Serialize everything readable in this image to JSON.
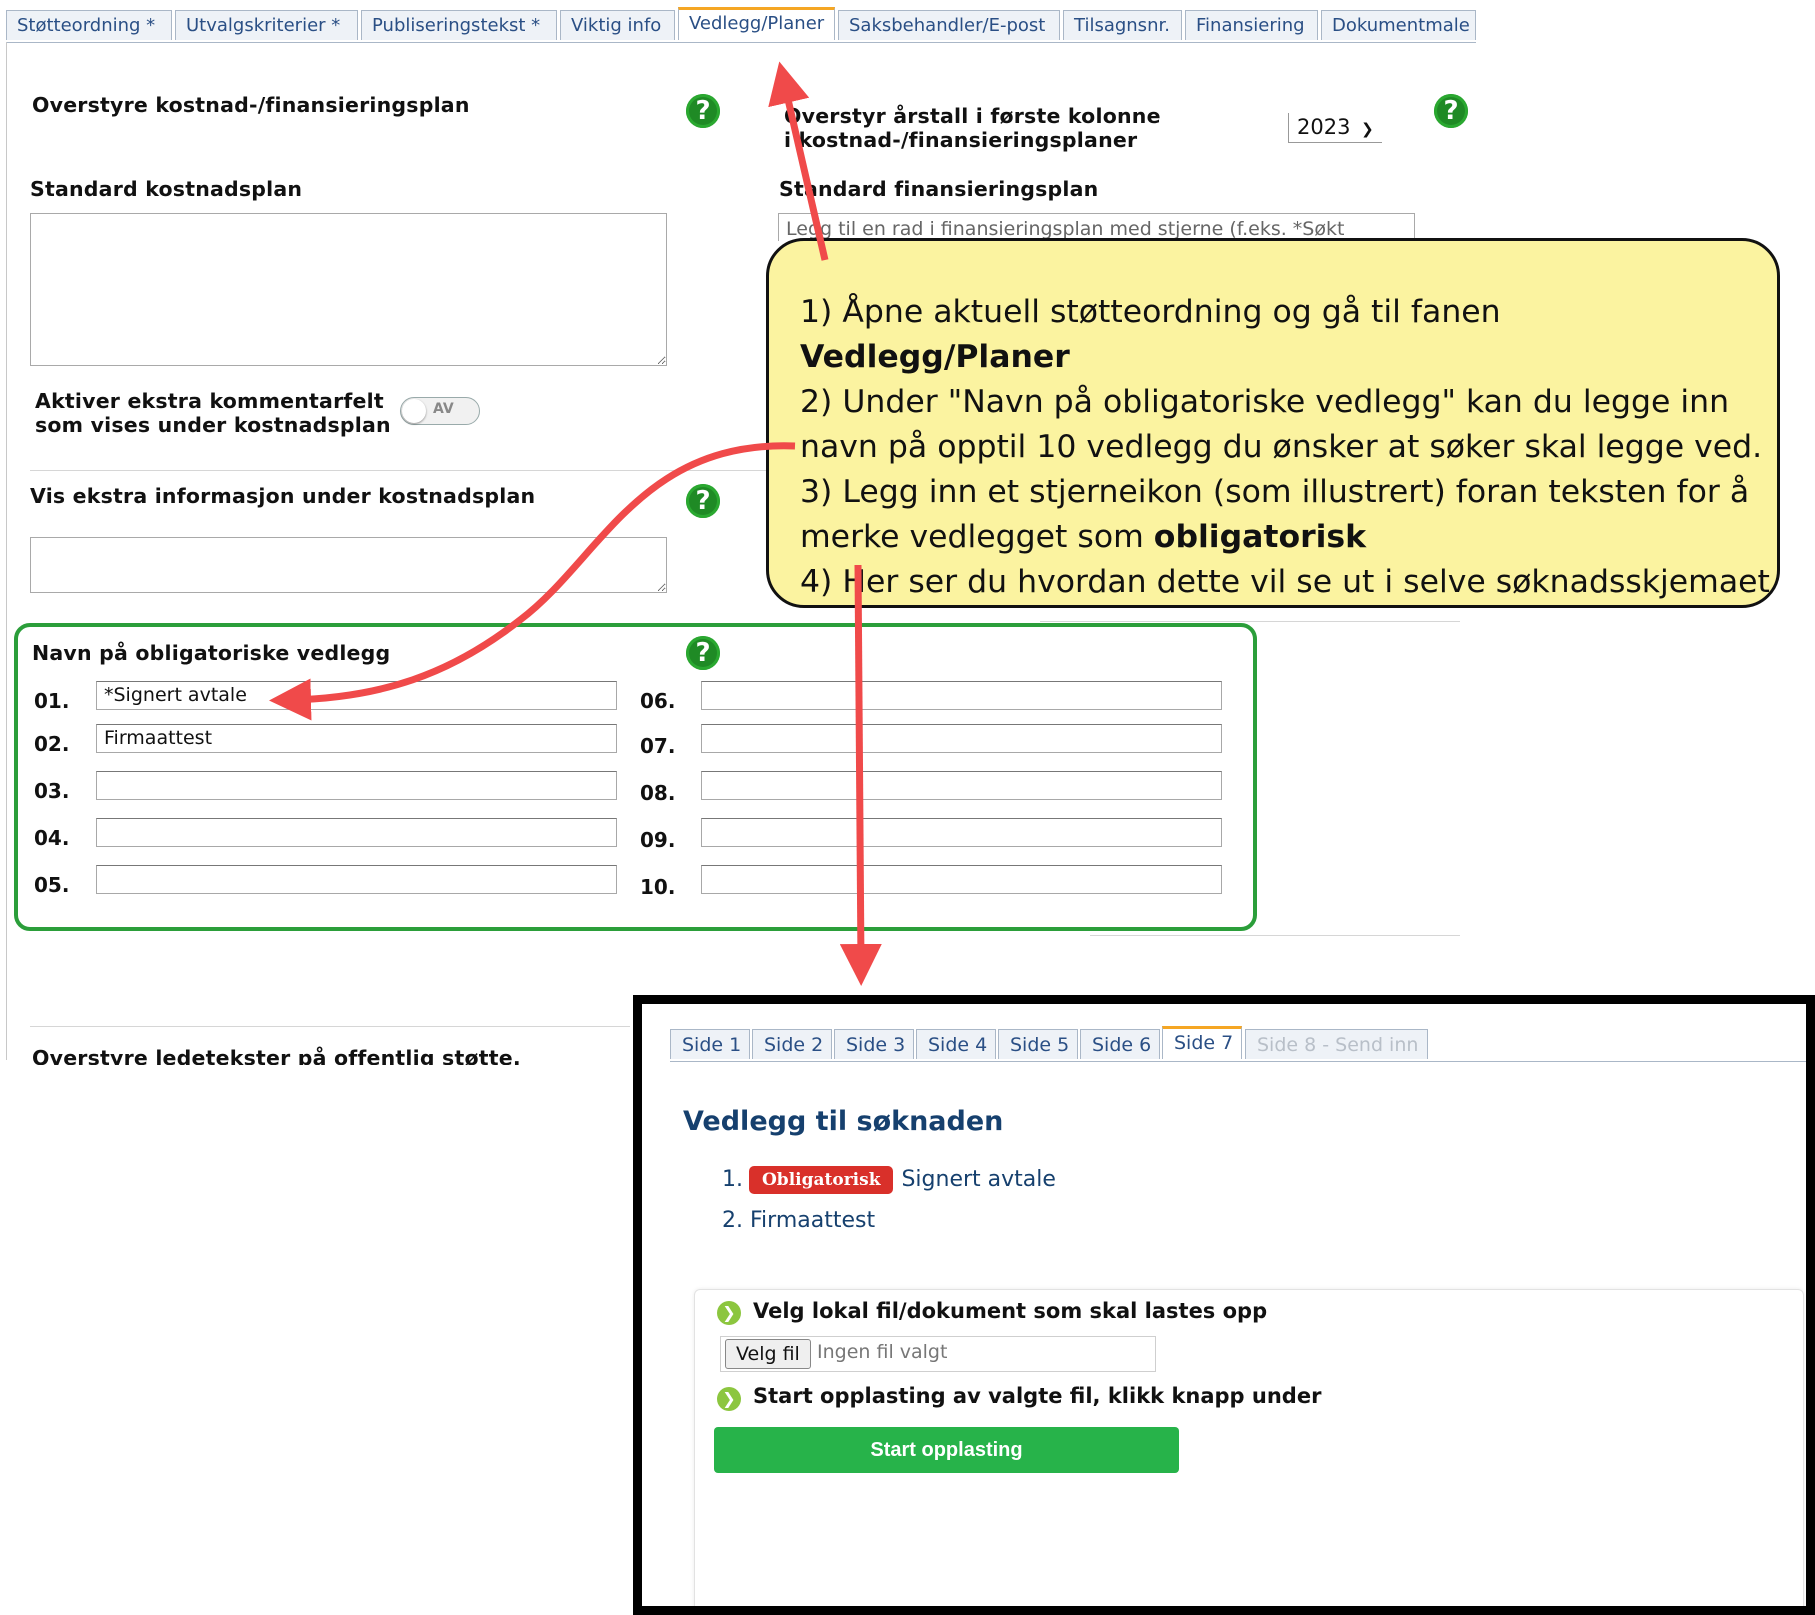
{
  "tabs": [
    {
      "label": "Støtteordning *",
      "active": false
    },
    {
      "label": "Utvalgskriterier *",
      "active": false
    },
    {
      "label": "Publiseringstekst *",
      "active": false
    },
    {
      "label": "Viktig info",
      "active": false
    },
    {
      "label": "Vedlegg/Planer",
      "active": true
    },
    {
      "label": "Saksbehandler/E-post",
      "active": false
    },
    {
      "label": "Tilsagnsnr.",
      "active": false
    },
    {
      "label": "Finansiering",
      "active": false
    },
    {
      "label": "Dokumentmale",
      "active": false
    }
  ],
  "left": {
    "override_plan_label": "Overstyre kostnad-/finansieringsplan",
    "standard_cost_plan_label": "Standard kostnadsplan",
    "extra_comment_label_1": "Aktiver ekstra kommentarfelt",
    "extra_comment_label_2": "som vises under kostnadsplan",
    "toggle_text": "AV",
    "extra_info_label": "Vis ekstra informasjon under kostnadsplan",
    "mandatory_attachments_label": "Navn på obligatoriske vedlegg",
    "bottom_cut_label": "Overstyre ledetekster på offentlig støtte."
  },
  "right": {
    "year_label_1": "Overstyr årstall i første kolonne",
    "year_label_2": "i kostnad-/finansieringsplaner",
    "year_value": "2023",
    "standard_finance_plan_label": "Standard finansieringsplan",
    "finance_plan_text": "Legg til en rad i finansieringsplan med stjerne (f.eks. *Søkt"
  },
  "attachments": [
    {
      "num": "01.",
      "value": "*Signert avtale"
    },
    {
      "num": "02.",
      "value": "Firmaattest"
    },
    {
      "num": "03.",
      "value": ""
    },
    {
      "num": "04.",
      "value": ""
    },
    {
      "num": "05.",
      "value": ""
    },
    {
      "num": "06.",
      "value": ""
    },
    {
      "num": "07.",
      "value": ""
    },
    {
      "num": "08.",
      "value": ""
    },
    {
      "num": "09.",
      "value": ""
    },
    {
      "num": "10.",
      "value": ""
    }
  ],
  "callout": {
    "line1_prefix": "1) Åpne aktuell støtteordning og gå til fanen ",
    "line1_bold": "Vedlegg/Planer",
    "line2": "2) Under \"Navn på obligatoriske vedlegg\" kan du legge inn navn på opptil 10 vedlegg du ønsker at søker skal legge ved.",
    "line3_prefix": "3) Legg inn et stjerneikon (som illustrert) foran teksten for å merke vedlegget som ",
    "line3_bold": "obligatorisk",
    "line4": "4) Her ser du hvordan dette vil se ut i selve søknadsskjemaet"
  },
  "preview": {
    "tabs": [
      {
        "label": "Side 1",
        "state": "normal"
      },
      {
        "label": "Side 2",
        "state": "normal"
      },
      {
        "label": "Side 3",
        "state": "normal"
      },
      {
        "label": "Side 4",
        "state": "normal"
      },
      {
        "label": "Side 5",
        "state": "normal"
      },
      {
        "label": "Side 6",
        "state": "normal"
      },
      {
        "label": "Side 7",
        "state": "active"
      },
      {
        "label": "Side 8 - Send inn",
        "state": "disabled"
      }
    ],
    "title": "Vedlegg til søknaden",
    "items": [
      {
        "num": "1.",
        "badge": "Obligatorisk",
        "text": "Signert avtale"
      },
      {
        "num": "2.",
        "badge": "",
        "text": "Firmaattest"
      }
    ],
    "step1": "Velg lokal fil/dokument som skal lastes opp",
    "file_button": "Velg fil",
    "file_status": "Ingen fil valgt",
    "step2": "Start opplasting av valgte fil, klikk knapp under",
    "upload_button": "Start opplasting"
  },
  "colors": {
    "accent_red": "#f04a4a",
    "frame_green": "#2b9e3a",
    "callout_bg": "#fbf3a0",
    "badge_red": "#d9302a",
    "upload_green": "#27b34a"
  }
}
